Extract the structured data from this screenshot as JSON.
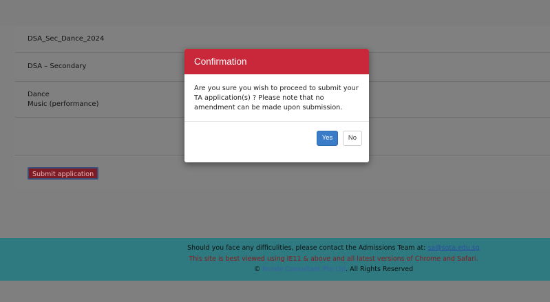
{
  "form": {
    "scheme_code": "DSA_Sec_Dance_2024",
    "scheme_type": "DSA – Secondary",
    "talent_areas": [
      "Dance",
      "Music (performance)"
    ],
    "submit_label": "Submit application"
  },
  "modal": {
    "title": "Confirmation",
    "body_line1": "Are you sure you wish to proceed to submit your",
    "body_line2": "TA application(s) ? Please note that no",
    "body_line3": "amendment can be made upon submission.",
    "yes_label": "Yes",
    "no_label": "No"
  },
  "footer": {
    "contact_text": "Should you face any difficulities, please contact the Admissions Team at: ",
    "contact_email": "sa@sota.edu.sg",
    "browser_notice": "This site is best viewed using IE11 & above and all latest versions of Chrome and Safari.",
    "copyright_symbol": "©",
    "company": "Ncode Consultant Pte Ltd",
    "rights": ". All Rights Reserved"
  },
  "colors": {
    "modal_header": "#c9283a",
    "yes_button": "#3a7cc8",
    "footer_bg": "#2e7a80"
  }
}
